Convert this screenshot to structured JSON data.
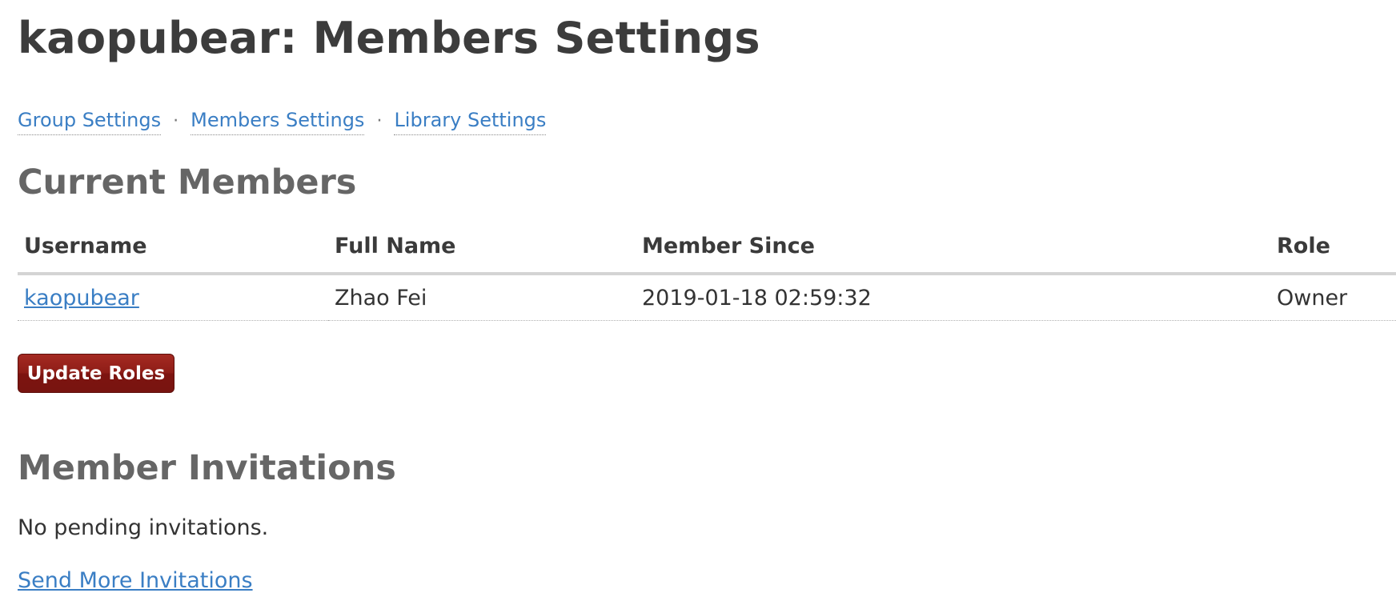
{
  "page": {
    "title": "kaopubear: Members Settings"
  },
  "subnav": {
    "separator": "·",
    "items": [
      {
        "label": "Group Settings"
      },
      {
        "label": "Members Settings"
      },
      {
        "label": "Library Settings"
      }
    ]
  },
  "current_members": {
    "title": "Current Members",
    "columns": [
      "Username",
      "Full Name",
      "Member Since",
      "Role"
    ],
    "rows": [
      {
        "username": "kaopubear",
        "full_name": "Zhao Fei",
        "member_since": "2019-01-18 02:59:32",
        "role": "Owner"
      }
    ],
    "update_button_label": "Update Roles"
  },
  "member_invitations": {
    "title": "Member Invitations",
    "empty_text": "No pending invitations.",
    "send_link_label": "Send More Invitations"
  },
  "colors": {
    "link": "#3a7ec4",
    "button": "#8e1d17",
    "heading": "#3c3c3c"
  }
}
